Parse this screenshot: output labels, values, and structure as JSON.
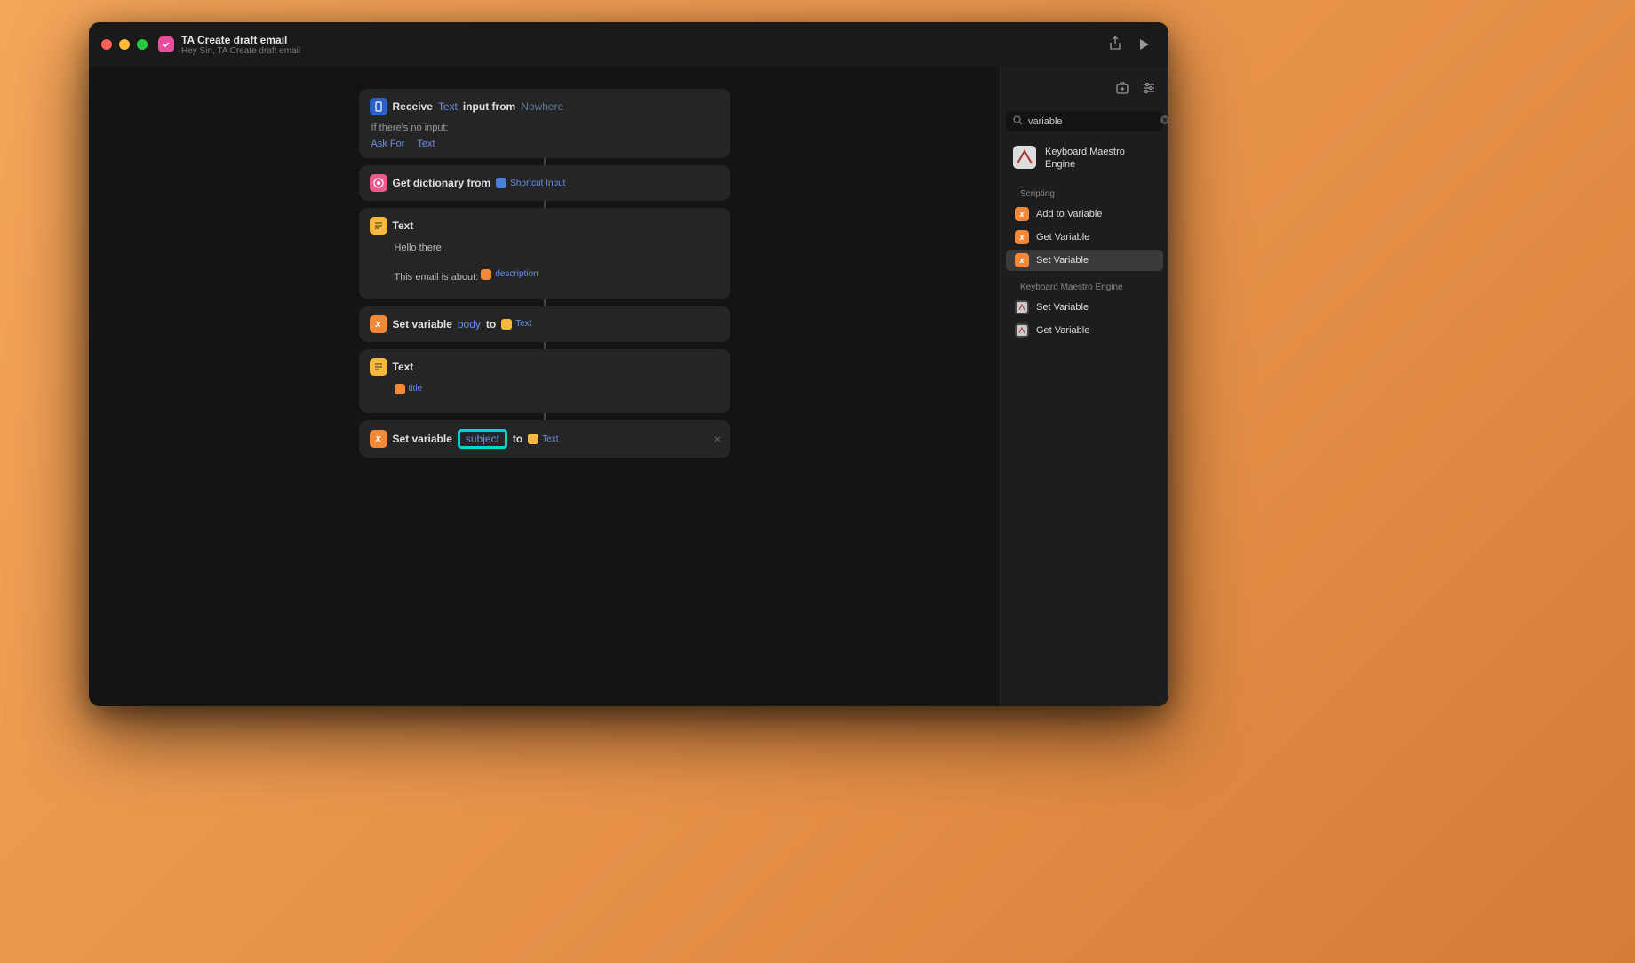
{
  "header": {
    "title": "TA Create draft email",
    "subtitle": "Hey Siri, TA Create draft email"
  },
  "actions": {
    "receive": {
      "label": "Receive",
      "type": "Text",
      "middle": "input from",
      "source": "Nowhere",
      "no_input_label": "If there's no input:",
      "ask_for": "Ask For",
      "ask_for_type": "Text"
    },
    "get_dict": {
      "label": "Get dictionary from",
      "source": "Shortcut Input"
    },
    "text1": {
      "label": "Text",
      "line1": "Hello there,",
      "line2_prefix": "This email is about:",
      "line2_token": "description"
    },
    "setvar1": {
      "label": "Set variable",
      "var": "body",
      "to": "to",
      "target": "Text"
    },
    "text2": {
      "label": "Text",
      "token": "title"
    },
    "setvar2": {
      "label": "Set variable",
      "var": "subject",
      "to": "to",
      "target": "Text"
    }
  },
  "sidebar": {
    "search_value": "variable",
    "app": {
      "name": "Keyboard Maestro Engine"
    },
    "categories": [
      {
        "name": "Scripting",
        "items": [
          {
            "label": "Add to Variable",
            "icon": "x"
          },
          {
            "label": "Get Variable",
            "icon": "x"
          },
          {
            "label": "Set Variable",
            "icon": "x",
            "selected": true
          }
        ]
      },
      {
        "name": "Keyboard Maestro Engine",
        "items": [
          {
            "label": "Set Variable",
            "icon": "km"
          },
          {
            "label": "Get Variable",
            "icon": "km"
          }
        ]
      }
    ]
  }
}
